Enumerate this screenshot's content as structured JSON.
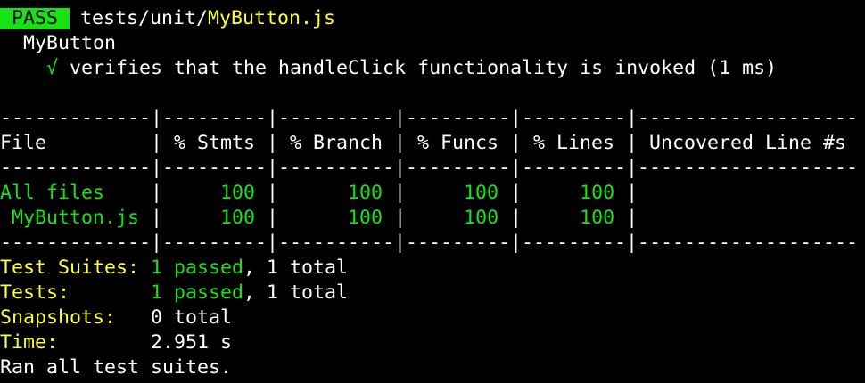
{
  "colors": {
    "background": "#000000",
    "text": "#ffffff",
    "pass_green": "#16e216",
    "label_yellow": "#ffff33"
  },
  "header": {
    "badge": "PASS",
    "path_prefix": "tests/unit/",
    "file_name": "MyButton.js"
  },
  "suite": {
    "name": "MyButton",
    "check_icon": "√",
    "test_name": "verifies that the handleClick functionality is invoked (1 ms)"
  },
  "coverage": {
    "separator_top": "-------------|---------|----------|---------|---------|-------------------",
    "headers": [
      "File",
      "% Stmts",
      "% Branch",
      "% Funcs",
      "% Lines",
      "Uncovered Line #s"
    ],
    "header_row": "File         | % Stmts | % Branch | % Funcs | % Lines | Uncovered Line #s",
    "separator_mid": "-------------|---------|----------|---------|---------|-------------------",
    "rows": [
      {
        "file": "All files",
        "stmts": "100",
        "branch": "100",
        "funcs": "100",
        "lines": "100",
        "uncovered": ""
      },
      {
        "file": "MyButton.js",
        "stmts": "100",
        "branch": "100",
        "funcs": "100",
        "lines": "100",
        "uncovered": ""
      }
    ],
    "separator_bottom": "-------------|---------|----------|---------|---------|-------------------"
  },
  "summary": {
    "suites_label": "Test Suites:",
    "suites_passed": "1 passed",
    "suites_total": ", 1 total",
    "tests_label": "Tests:",
    "tests_passed": "1 passed",
    "tests_total": ", 1 total",
    "snapshots_label": "Snapshots:",
    "snapshots_value": "0 total",
    "time_label": "Time:",
    "time_value": "2.951 s",
    "ran_all": "Ran all test suites."
  }
}
